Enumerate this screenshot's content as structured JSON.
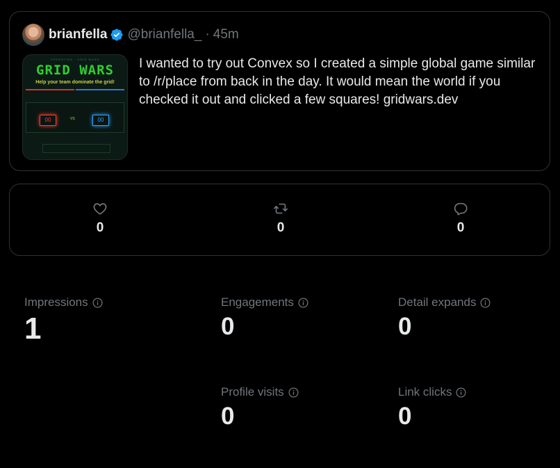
{
  "tweet": {
    "display_name": "brianfella",
    "handle": "@brianfella_",
    "separator": "·",
    "time": "45m",
    "verified_icon": "verified-badge-icon",
    "text": "I wanted to try out Convex so I created a simple global game similar to /r/place from back in the day. It would mean the world if you checked it out and clicked a few squares! gridwars.dev",
    "media": {
      "top_text": "OPERATION · GRID WARS",
      "title": "GRID WARS",
      "subtitle": "Help your team dominate the grid!",
      "red_score": "00",
      "blue_score": "00",
      "vs": "VS"
    }
  },
  "stats": {
    "likes": "0",
    "retweets": "0",
    "replies": "0",
    "icons": {
      "likes": "heart-icon",
      "retweets": "retweet-icon",
      "replies": "reply-icon"
    }
  },
  "metrics": {
    "impressions": {
      "label": "Impressions",
      "value": "1"
    },
    "engagements": {
      "label": "Engagements",
      "value": "0"
    },
    "detail_expands": {
      "label": "Detail expands",
      "value": "0"
    },
    "profile_visits": {
      "label": "Profile visits",
      "value": "0"
    },
    "link_clicks": {
      "label": "Link clicks",
      "value": "0"
    }
  },
  "colors": {
    "background": "#000000",
    "border": "#2f3336",
    "primary_text": "#e7e9ea",
    "secondary_text": "#71767b",
    "verified": "#1d9bf0"
  }
}
